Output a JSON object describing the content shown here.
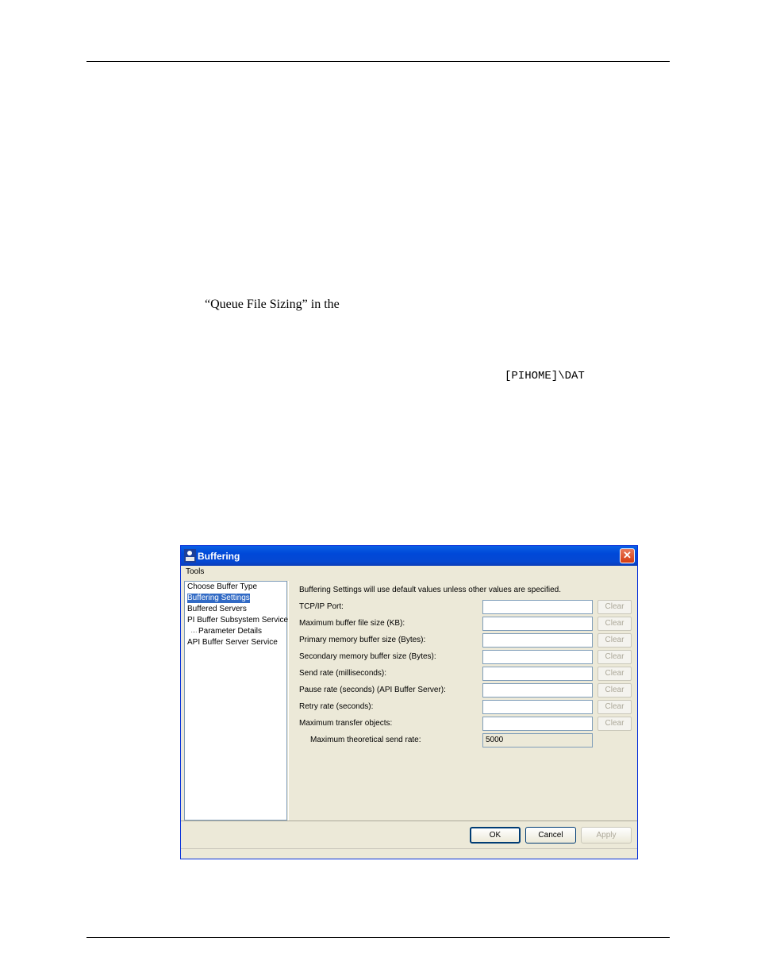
{
  "document": {
    "fragment_1": "“Queue File Sizing” in the",
    "fragment_2": "[PIHOME]\\DAT"
  },
  "dialog": {
    "title": "Buffering",
    "close_symbol": "✕",
    "menu": [
      "Tools"
    ],
    "nav_items": [
      "Choose Buffer Type",
      "Buffering Settings",
      "Buffered Servers",
      "PI Buffer Subsystem Service",
      "Parameter Details",
      "API Buffer Server Service"
    ],
    "selected_nav": "Buffering Settings",
    "panel_heading": "Buffering Settings will use default values unless other values are specified.",
    "fields": [
      {
        "label": "TCP/IP Port:",
        "value": "",
        "clear": "Clear"
      },
      {
        "label": "Maximum buffer file size (KB):",
        "value": "",
        "clear": "Clear"
      },
      {
        "label": "Primary memory buffer size (Bytes):",
        "value": "",
        "clear": "Clear"
      },
      {
        "label": "Secondary memory buffer size (Bytes):",
        "value": "",
        "clear": "Clear"
      },
      {
        "label": "Send rate (milliseconds):",
        "value": "",
        "clear": "Clear"
      },
      {
        "label": "Pause rate (seconds) (API Buffer Server):",
        "value": "",
        "clear": "Clear"
      },
      {
        "label": "Retry rate (seconds):",
        "value": "",
        "clear": "Clear"
      },
      {
        "label": "Maximum transfer objects:",
        "value": "",
        "clear": "Clear"
      }
    ],
    "max_send_rate": {
      "label": "Maximum theoretical send rate:",
      "value": "5000"
    },
    "buttons": {
      "ok": "OK",
      "cancel": "Cancel",
      "apply": "Apply"
    }
  }
}
